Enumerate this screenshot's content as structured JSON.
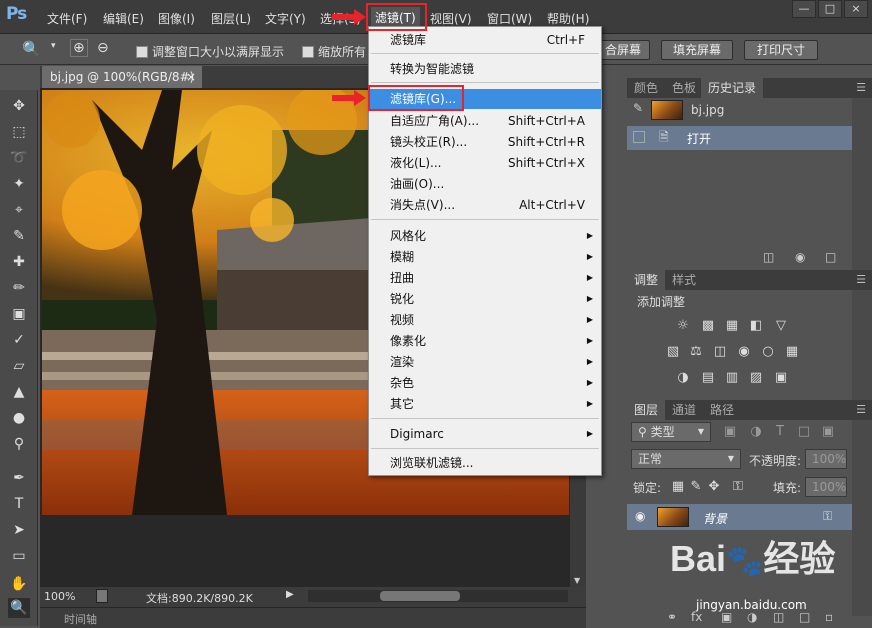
{
  "menubar": {
    "logo": "Ps",
    "items": [
      "文件(F)",
      "编辑(E)",
      "图像(I)",
      "图层(L)",
      "文字(Y)",
      "选择(S)",
      "滤镜(T)",
      "视图(V)",
      "窗口(W)",
      "帮助(H)"
    ],
    "active_item": "滤镜(T)",
    "window_controls": [
      "—",
      "□",
      "×"
    ]
  },
  "options_bar": {
    "resize_windows_label": "调整窗口大小以满屏显示",
    "zoom_all_label": "缩放所有",
    "fit_screen_label": "合屏幕",
    "fill_screen_label": "填充屏幕",
    "print_size_label": "打印尺寸"
  },
  "document": {
    "tab_title": "bj.jpg @ 100%(RGB/8#)",
    "tab_close": "×",
    "zoom": "100%",
    "doc_info": "文档:890.2K/890.2K",
    "timeline_label": "时间轴"
  },
  "filter_menu": {
    "items": [
      {
        "label": "滤镜库",
        "shortcut": "Ctrl+F"
      },
      {
        "label": "转换为智能滤镜",
        "shortcut": ""
      },
      {
        "label": "滤镜库(G)...",
        "shortcut": "",
        "highlighted": true
      },
      {
        "label": "自适应广角(A)...",
        "shortcut": "Shift+Ctrl+A"
      },
      {
        "label": "镜头校正(R)...",
        "shortcut": "Shift+Ctrl+R"
      },
      {
        "label": "液化(L)...",
        "shortcut": "Shift+Ctrl+X"
      },
      {
        "label": "油画(O)...",
        "shortcut": ""
      },
      {
        "label": "消失点(V)...",
        "shortcut": "Alt+Ctrl+V"
      },
      {
        "label": "风格化",
        "submenu": true
      },
      {
        "label": "模糊",
        "submenu": true
      },
      {
        "label": "扭曲",
        "submenu": true
      },
      {
        "label": "锐化",
        "submenu": true
      },
      {
        "label": "视频",
        "submenu": true
      },
      {
        "label": "像素化",
        "submenu": true
      },
      {
        "label": "渲染",
        "submenu": true
      },
      {
        "label": "杂色",
        "submenu": true
      },
      {
        "label": "其它",
        "submenu": true
      },
      {
        "label": "Digimarc",
        "submenu": true
      },
      {
        "label": "浏览联机滤镜..."
      }
    ]
  },
  "panels": {
    "top_tabs": [
      "颜色",
      "色板",
      "历史记录"
    ],
    "history_snapshot": "bj.jpg",
    "history_items": [
      "打开"
    ],
    "adjust_tabs": [
      "调整",
      "样式"
    ],
    "adjust_title": "添加调整",
    "layer_tabs": [
      "图层",
      "通道",
      "路径"
    ],
    "kind_label": "类型",
    "blend_mode": "正常",
    "opacity_label": "不透明度:",
    "opacity_value": "100%",
    "lock_label": "锁定:",
    "fill_label": "填充:",
    "fill_value": "100%",
    "layer_name": "背景"
  },
  "watermark": {
    "brand": "Bai",
    "suffix": "经验",
    "url": "jingyan.baidu.com"
  },
  "colors": {
    "accent": "#3c8ee2",
    "annotation": "#e8232b",
    "logo": "#7fb6ea"
  }
}
